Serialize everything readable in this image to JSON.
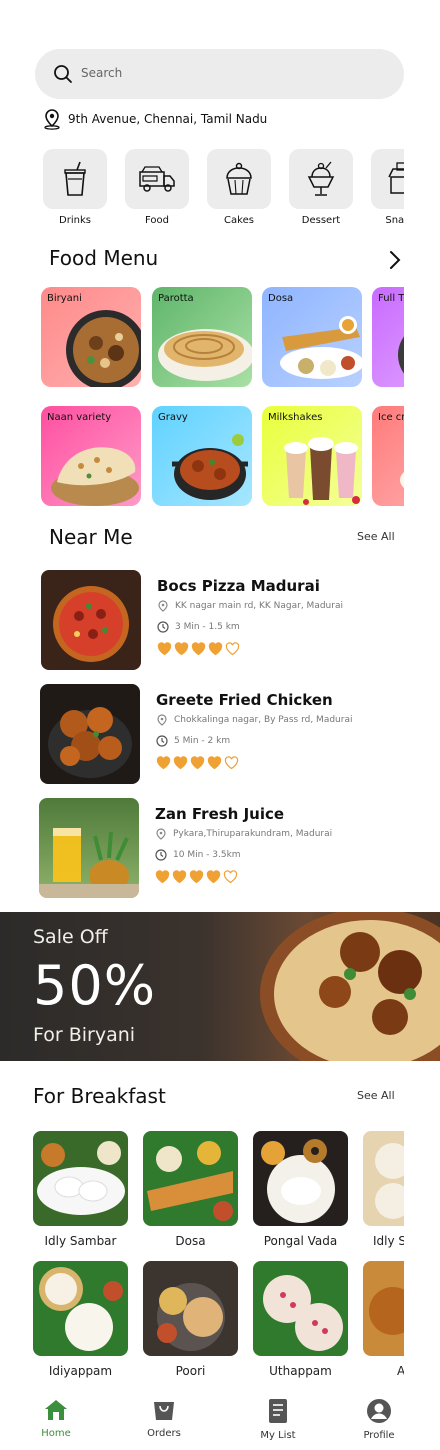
{
  "search": {
    "placeholder": "Search"
  },
  "location": {
    "text": "9th Avenue, Chennai, Tamil Nadu"
  },
  "categories": [
    {
      "label": "Drinks",
      "icon": "drink-cup-icon"
    },
    {
      "label": "Food",
      "icon": "food-truck-icon"
    },
    {
      "label": "Cakes",
      "icon": "cupcake-icon"
    },
    {
      "label": "Dessert",
      "icon": "ice-cream-sundae-icon"
    },
    {
      "label": "Snacks",
      "icon": "snack-stand-icon"
    }
  ],
  "food_menu": {
    "title": "Food Menu",
    "row1": [
      {
        "label": "Biryani"
      },
      {
        "label": "Parotta"
      },
      {
        "label": "Dosa"
      },
      {
        "label": "Full Thali"
      }
    ],
    "row2": [
      {
        "label": "Naan variety"
      },
      {
        "label": "Gravy"
      },
      {
        "label": "Milkshakes"
      },
      {
        "label": "Ice cream"
      }
    ]
  },
  "near_me": {
    "title": "Near Me",
    "see_all": "See All",
    "items": [
      {
        "name": "Bocs Pizza Madurai",
        "address": "KK nagar main rd, KK Nagar, Madurai",
        "time": "3 Min - 1.5 km",
        "rating": 4
      },
      {
        "name": "Greete Fried Chicken",
        "address": "Chokkalinga nagar, By Pass rd, Madurai",
        "time": "5 Min - 2 km",
        "rating": 4
      },
      {
        "name": "Zan Fresh Juice",
        "address": "Pykara,Thiruparakundram, Madurai",
        "time": "10 Min - 3.5km",
        "rating": 4
      }
    ]
  },
  "banner": {
    "line1": "Sale Off",
    "line2": "50%",
    "line3": "For Biryani"
  },
  "breakfast": {
    "title": "For Breakfast",
    "see_all": "See All",
    "row1": [
      {
        "label": "Idly Sambar"
      },
      {
        "label": "Dosa"
      },
      {
        "label": "Pongal Vada"
      },
      {
        "label": "Idly S"
      }
    ],
    "row2": [
      {
        "label": "Idiyappam"
      },
      {
        "label": "Poori"
      },
      {
        "label": "Uthappam"
      },
      {
        "label": "A"
      }
    ]
  },
  "nav": [
    {
      "label": "Home",
      "icon": "home-icon",
      "active": true
    },
    {
      "label": "Orders",
      "icon": "shopping-bag-icon"
    },
    {
      "label": "My List",
      "icon": "list-document-icon"
    },
    {
      "label": "Profile",
      "icon": "profile-icon"
    }
  ],
  "colors": {
    "accent": "#3c8f3c",
    "heart": "#f0a133",
    "search_bg": "#ececec"
  }
}
